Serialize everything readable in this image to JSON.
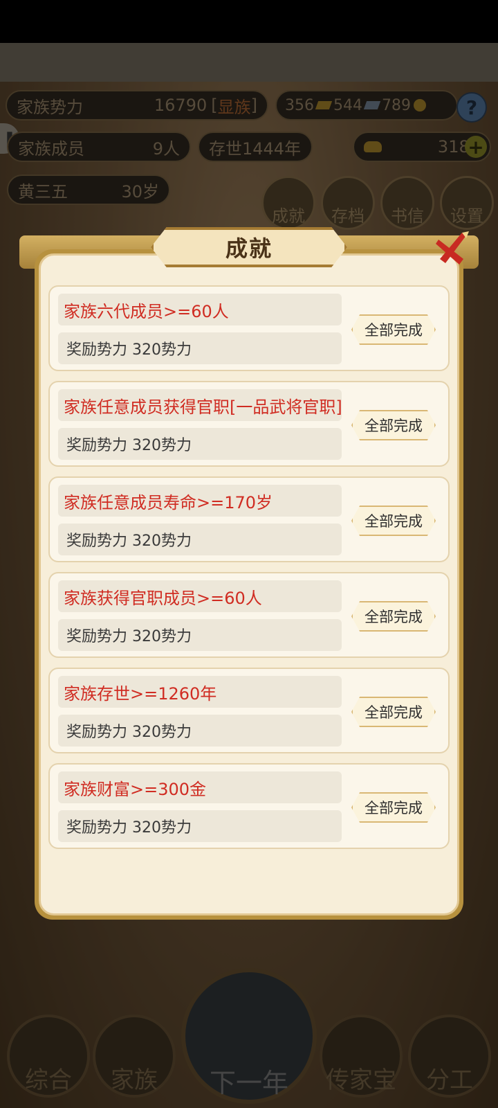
{
  "hud": {
    "influence_label": "家族势力",
    "influence_value": "16790",
    "influence_rank_open": "[",
    "influence_rank": "显族",
    "influence_rank_close": "]",
    "currency_a": "356",
    "currency_b": "544",
    "currency_c": "789",
    "help": "?",
    "members_label": "家族成员",
    "members_value": "9人",
    "years": "存世1444年",
    "gold": "3189",
    "plus": "+",
    "char_name": "黄三五",
    "char_age": "30岁",
    "round_buttons": [
      "成就",
      "存档",
      "书信",
      "设置"
    ]
  },
  "bottom_nav": {
    "items": [
      "综合",
      "家族",
      "下一年",
      "传家宝",
      "分工"
    ]
  },
  "modal": {
    "title": "成就",
    "achievements": [
      {
        "title": "家族六代成员>=60人",
        "reward": "奖励势力 320势力",
        "status": "全部完成"
      },
      {
        "title": "家族任意成员获得官职[一品武将官职]",
        "reward": "奖励势力 320势力",
        "status": "全部完成"
      },
      {
        "title": "家族任意成员寿命>=170岁",
        "reward": "奖励势力 320势力",
        "status": "全部完成"
      },
      {
        "title": "家族获得官职成员>=60人",
        "reward": "奖励势力 320势力",
        "status": "全部完成"
      },
      {
        "title": "家族存世>=1260年",
        "reward": "奖励势力 320势力",
        "status": "全部完成"
      },
      {
        "title": "家族财富>=300金",
        "reward": "奖励势力 320势力",
        "status": "全部完成"
      }
    ]
  },
  "colors": {
    "accent_red": "#d02c22",
    "frame_gold": "#b7913e",
    "panel_cream": "#f7eed9"
  }
}
